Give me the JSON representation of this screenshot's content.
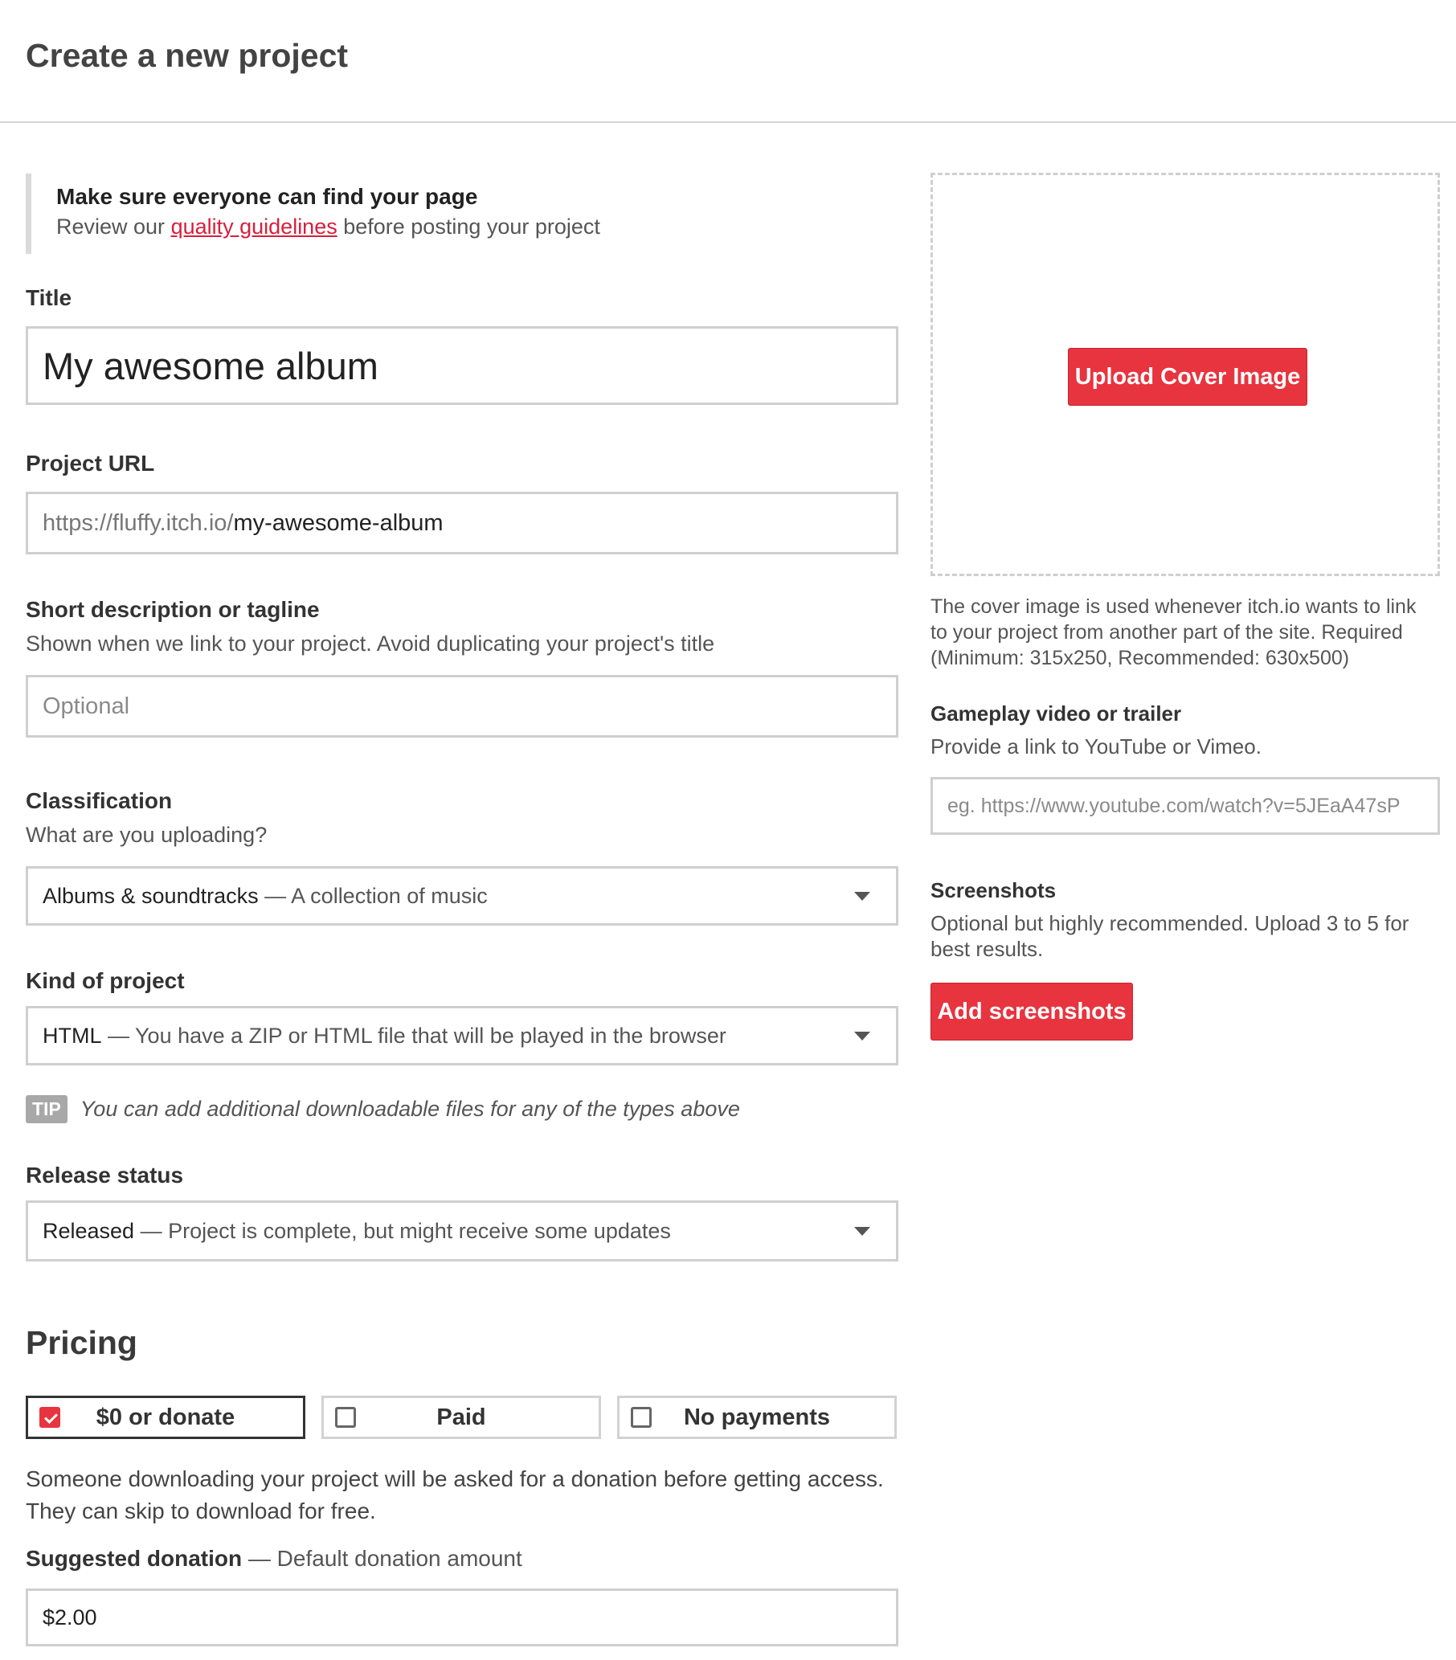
{
  "page": {
    "title": "Create a new project"
  },
  "notice": {
    "title": "Make sure everyone can find your page",
    "before": "Review our",
    "link": "quality guidelines",
    "after": "before posting your project"
  },
  "title_field": {
    "label": "Title",
    "value": "My awesome album"
  },
  "url_field": {
    "label": "Project URL",
    "prefix": "https://fluffy.itch.io/",
    "value": "my-awesome-album"
  },
  "tagline": {
    "label": "Short description or tagline",
    "sublabel": "Shown when we link to your project. Avoid duplicating your project's title",
    "placeholder": "Optional"
  },
  "classification": {
    "label": "Classification",
    "sublabel": "What are you uploading?",
    "selected": "Albums & soundtracks",
    "desc": "— A collection of music"
  },
  "kind": {
    "label": "Kind of project",
    "selected": "HTML",
    "desc": "— You have a ZIP or HTML file that will be played in the browser"
  },
  "tip": {
    "badge": "TIP",
    "text": "You can add additional downloadable files for any of the types above"
  },
  "release": {
    "label": "Release status",
    "selected": "Released",
    "desc": "— Project is complete, but might receive some updates"
  },
  "pricing": {
    "title": "Pricing",
    "options": [
      {
        "label": "$0 or donate",
        "selected": true
      },
      {
        "label": "Paid",
        "selected": false
      },
      {
        "label": "No payments",
        "selected": false
      }
    ],
    "description_line1": "Someone downloading your project will be asked for a donation before getting access.",
    "description_line2": "They can skip to download for free."
  },
  "donation": {
    "label": "Suggested donation",
    "desc": "— Default donation amount",
    "value": "$2.00"
  },
  "cover": {
    "button": "Upload Cover Image",
    "help_line1": "The cover image is used whenever itch.io wants to link",
    "help_line2": "to your project from another part of the site. Required",
    "help_line3": "(Minimum: 315x250, Recommended: 630x500)"
  },
  "video": {
    "label": "Gameplay video or trailer",
    "sublabel": "Provide a link to YouTube or Vimeo.",
    "placeholder": "eg. https://www.youtube.com/watch?v=5JEaA47sP"
  },
  "screenshots": {
    "label": "Screenshots",
    "sublabel_line1": "Optional but highly recommended. Upload 3 to 5 for",
    "sublabel_line2": "best results.",
    "button": "Add screenshots"
  },
  "colors": {
    "accent": "#e8343f",
    "link": "#d91e3a",
    "border": "#cfcfcf"
  },
  "icons": {
    "dropdown": "caret-down-icon",
    "checkbox": "checkbox-icon"
  }
}
